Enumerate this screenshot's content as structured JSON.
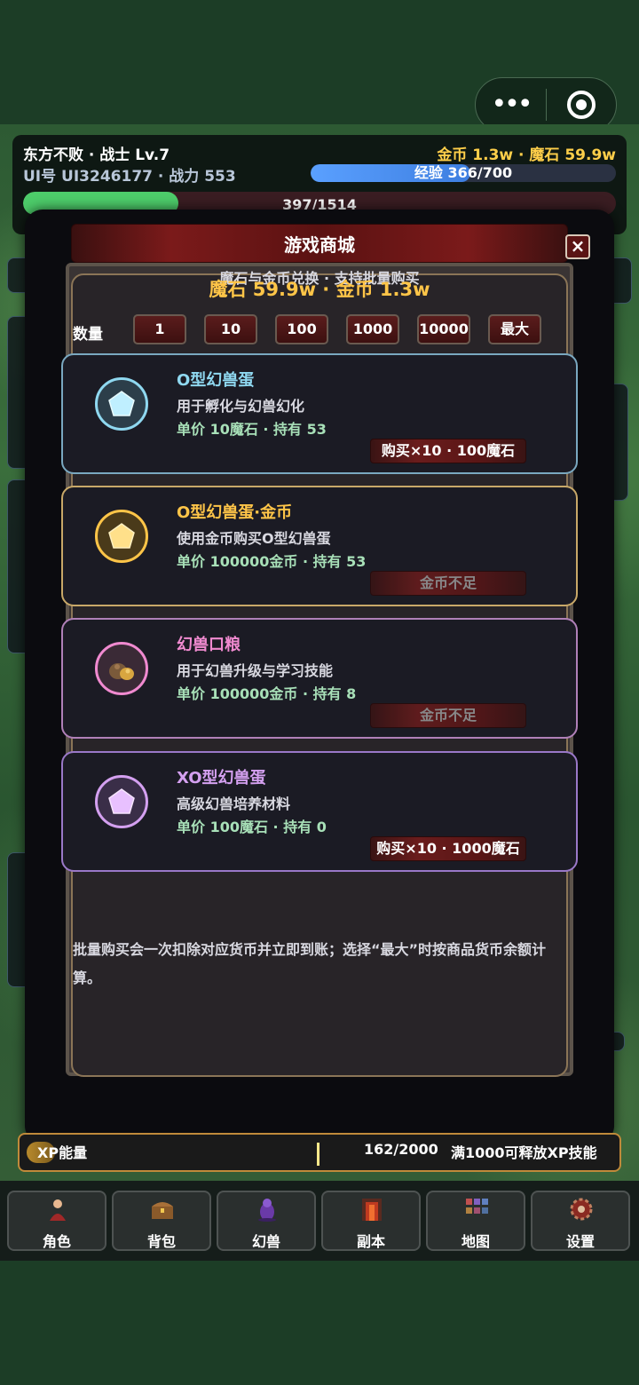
{
  "player": {
    "name_line": "东方不败 · 战士 Lv.7",
    "id_line": "UI号 UI3246177 · 战力 553",
    "currency_line": "金币 1.3w · 魔石 59.9w",
    "exp_text": "经验 366/700",
    "exp_current": 366,
    "exp_max": 700,
    "hp_text": "397/1514",
    "hp_current": 397,
    "hp_max": 1514
  },
  "shop": {
    "title": "游戏商城",
    "close_label": "×",
    "subtitle": "魔石与金币兑换 · 支持批量购买",
    "balance": "魔石 59.9w · 金币 1.3w",
    "quantity_label": "数量",
    "quantities": [
      "1",
      "10",
      "100",
      "1000",
      "10000",
      "最大"
    ],
    "items": [
      {
        "name": "O型幻兽蛋",
        "desc": "用于孵化与幻兽幻化",
        "price": "单价 10魔石 · 持有 53",
        "button": "购买×10 · 100魔石",
        "enabled": true,
        "color": "#8fd8f0",
        "icon": "pentagon-egg-icon"
      },
      {
        "name": "O型幻兽蛋·金币",
        "desc": "使用金币购买O型幻兽蛋",
        "price": "单价 100000金币 · 持有 53",
        "button": "金币不足",
        "enabled": false,
        "color": "#ffc548",
        "icon": "pentagon-egg-icon"
      },
      {
        "name": "幻兽口粮",
        "desc": "用于幻兽升级与学习技能",
        "price": "单价 100000金币 · 持有 8",
        "button": "金币不足",
        "enabled": false,
        "color": "#f08ad0",
        "icon": "food-sack-icon"
      },
      {
        "name": "XO型幻兽蛋",
        "desc": "高级幻兽培养材料",
        "price": "单价 100魔石 · 持有 0",
        "button": "购买×10 · 1000魔石",
        "enabled": true,
        "color": "#d4a0f0",
        "icon": "pentagon-egg-icon"
      }
    ],
    "notice": "批量购买会一次扣除对应货币并立即到账；选择“最大”时按商品货币余额计算。"
  },
  "xp": {
    "label": "XP能量",
    "value": "162/2000",
    "hint": "满1000可释放XP技能",
    "current": 162,
    "max": 2000
  },
  "nav": [
    {
      "label": "角色",
      "icon": "character-icon"
    },
    {
      "label": "背包",
      "icon": "treasure-chest-icon"
    },
    {
      "label": "幻兽",
      "icon": "beast-icon"
    },
    {
      "label": "副本",
      "icon": "dungeon-gate-icon"
    },
    {
      "label": "地图",
      "icon": "map-icon"
    },
    {
      "label": "设置",
      "icon": "settings-gear-icon"
    }
  ]
}
